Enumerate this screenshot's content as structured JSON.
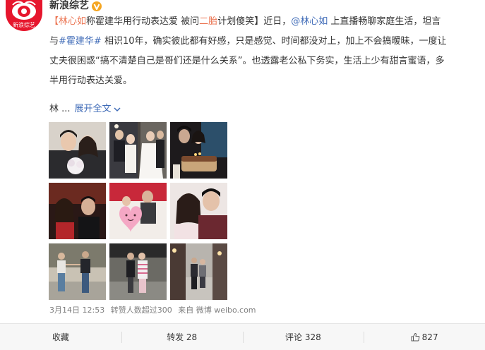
{
  "account": {
    "name": "新浪综艺",
    "avatar_label": "新浪综艺",
    "verified_icon": "verified-v-icon",
    "brand_color": "#e6162d"
  },
  "post": {
    "line1": {
      "bracket_open": "【",
      "name_highlight": "林心如",
      "title_mid": "称霍建华用行动表达爱 被问",
      "second_child": "二胎",
      "title_end": "计划傻笑】",
      "mid": "近日，",
      "mention": "@林心如",
      "tail": " 上直播畅聊家庭生活，坦言"
    },
    "line2": {
      "prefix": "与",
      "hashtag": "#霍建华#",
      "text": " 相识10年，确实彼此都有好感，只是感觉、时间都没对上，加上不会搞暧昧，一度让"
    },
    "line3": {
      "text": "丈夫很困惑“搞不清楚自己是哥们还是什么关系”。也透露老公私下务实，生活上少有甜言蜜语，多"
    },
    "line4": {
      "text": "半用行动表达关爱。"
    },
    "expand": {
      "prefix": "林 ...",
      "label": "展开全文",
      "icon": "chevron-down-icon"
    }
  },
  "photos": [
    {
      "name": "couple-portrait-flowers"
    },
    {
      "name": "wedding-group"
    },
    {
      "name": "birthday-cake"
    },
    {
      "name": "night-out-selfie"
    },
    {
      "name": "heart-pillow"
    },
    {
      "name": "couple-selfie"
    },
    {
      "name": "street-walk-1"
    },
    {
      "name": "street-walk-2"
    },
    {
      "name": "street-walk-night"
    }
  ],
  "meta": {
    "date": "3月14日 12:53",
    "reposts": "转赞人数超过300",
    "source": "来自 微博 weibo.com"
  },
  "actions": {
    "favorite": "收藏",
    "repost": "转发 28",
    "comment": "评论 328",
    "like": "827",
    "like_icon": "thumbs-up-icon"
  }
}
